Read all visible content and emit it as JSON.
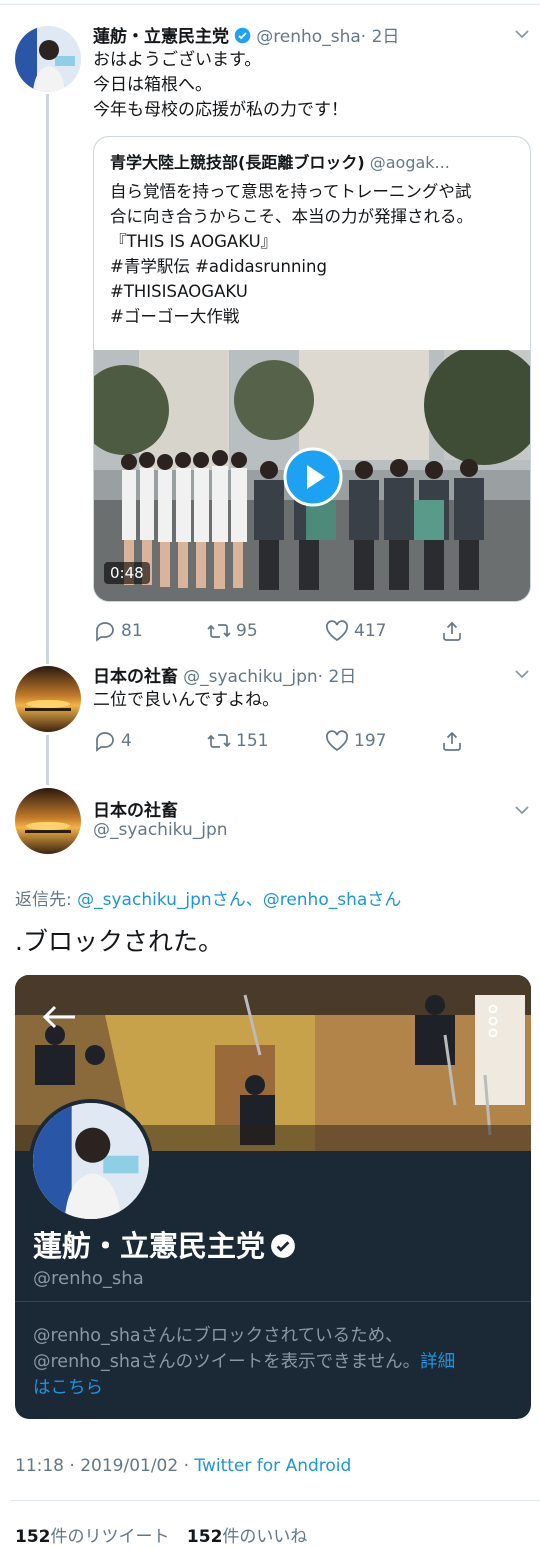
{
  "tweet1": {
    "name": "蓮舫・立憲民主党",
    "handle": "@renho_sha",
    "time": "· 2日",
    "lines": [
      "おはようございます。",
      "今日は箱根へ。",
      "今年も母校の応援が私の力です！"
    ],
    "quote": {
      "name": "青学大陸上競技部(長距離ブロック)",
      "handle": "@aogak...",
      "lines": [
        "自ら覚悟を持って意思を持ってトレーニングや試",
        "合に向き合うからこそ、本当の力が発揮される。",
        "『THIS IS AOGAKU』",
        "#青学駅伝 #adidasrunning",
        "#THISISAOGAKU",
        "#ゴーゴー大作戦"
      ],
      "video_duration": "0:48"
    },
    "replies": "81",
    "retweets": "95",
    "likes": "417"
  },
  "tweet2": {
    "name": "日本の社畜",
    "handle": "@_syachiku_jpn",
    "time": "· 2日",
    "text": "二位で良いんですよね。",
    "replies": "4",
    "retweets": "151",
    "likes": "197"
  },
  "main": {
    "name": "日本の社畜",
    "handle": "@_syachiku_jpn",
    "reply_label": "返信先:",
    "reply_to": "@_syachiku_jpnさん、@renho_shaさん",
    "text": ".ブロックされた。",
    "card": {
      "name": "蓮舫・立憲民主党",
      "handle": "@renho_sha",
      "blocked_line1": "@renho_shaさんにブロックされているため、",
      "blocked_line2": "@renho_shaさんのツイートを表示できません。",
      "details_link_1": "詳細",
      "details_link_2": "はこちら"
    },
    "timestamp": "11:18 · 2019/01/02 · ",
    "source": "Twitter for Android",
    "rt_count": "152",
    "rt_label": "件のリツイート",
    "like_count": "152",
    "like_label": "件のいいね"
  },
  "colors": {
    "accent": "#1b95e0",
    "secondary": "#657786",
    "divider": "#e1e8ed"
  }
}
